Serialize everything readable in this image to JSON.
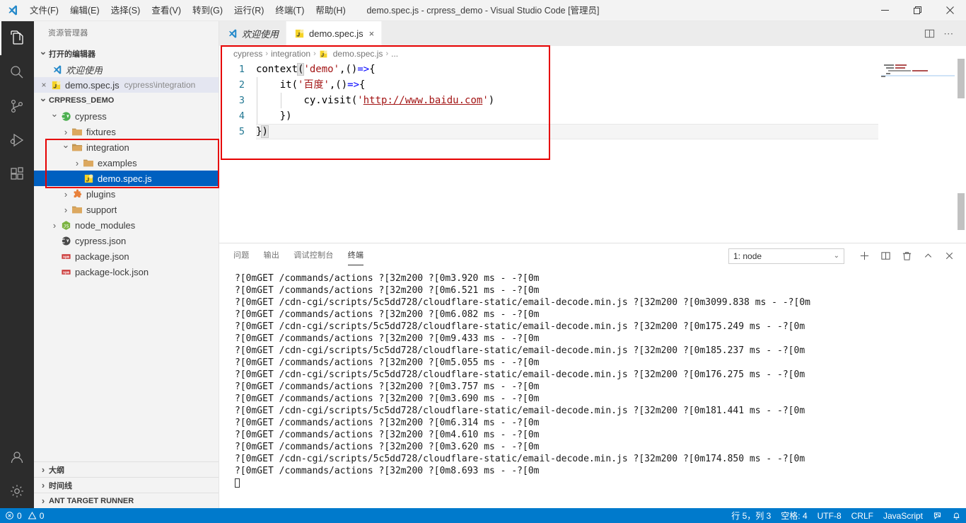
{
  "titlebar": {
    "window_title": "demo.spec.js - crpress_demo - Visual Studio Code [管理员]",
    "logo_icon": "vscode-logo-icon",
    "menus": [
      {
        "label": "文件(F)"
      },
      {
        "label": "编辑(E)"
      },
      {
        "label": "选择(S)"
      },
      {
        "label": "查看(V)"
      },
      {
        "label": "转到(G)"
      },
      {
        "label": "运行(R)"
      },
      {
        "label": "终端(T)"
      },
      {
        "label": "帮助(H)"
      }
    ],
    "controls": [
      {
        "name": "minimize-button",
        "icon": "minimize-icon"
      },
      {
        "name": "maximize-button",
        "icon": "restore-icon"
      },
      {
        "name": "close-button",
        "icon": "close-icon"
      }
    ]
  },
  "activitybar": {
    "items": [
      {
        "name": "explorer",
        "icon": "files-icon",
        "active": true
      },
      {
        "name": "search",
        "icon": "search-icon",
        "active": false
      },
      {
        "name": "source-control",
        "icon": "source-control-icon",
        "active": false
      },
      {
        "name": "run-debug",
        "icon": "run-debug-icon",
        "active": false
      },
      {
        "name": "extensions",
        "icon": "extensions-icon",
        "active": false
      }
    ],
    "bottom": [
      {
        "name": "accounts",
        "icon": "account-icon"
      },
      {
        "name": "manage",
        "icon": "gear-icon"
      }
    ]
  },
  "sidebar": {
    "title": "资源管理器",
    "open_editors": {
      "header": "打开的编辑器",
      "items": [
        {
          "label": "欢迎使用",
          "icon": "vscode-logo-icon",
          "italic": true,
          "sub": "",
          "active": false
        },
        {
          "label": "demo.spec.js",
          "icon": "js-test-icon",
          "italic": false,
          "sub": "cypress\\integration",
          "active": true,
          "close": "×"
        }
      ]
    },
    "project": {
      "header": "CRPRESS_DEMO",
      "tree": [
        {
          "label": "cypress",
          "icon": "cypress-icon",
          "indent": 1,
          "twisty": "down",
          "selected": false
        },
        {
          "label": "fixtures",
          "icon": "folder-icon",
          "indent": 2,
          "twisty": "right",
          "selected": false
        },
        {
          "label": "integration",
          "icon": "folder-open-icon",
          "indent": 2,
          "twisty": "down",
          "selected": false
        },
        {
          "label": "examples",
          "icon": "folder-icon",
          "indent": 3,
          "twisty": "right",
          "selected": false
        },
        {
          "label": "demo.spec.js",
          "icon": "js-test-icon",
          "indent": 4,
          "twisty": "none",
          "selected": true
        },
        {
          "label": "plugins",
          "icon": "plugin-icon",
          "indent": 2,
          "twisty": "right",
          "selected": false
        },
        {
          "label": "support",
          "icon": "folder-icon",
          "indent": 2,
          "twisty": "right",
          "selected": false
        },
        {
          "label": "node_modules",
          "icon": "node-icon",
          "indent": 1,
          "twisty": "right",
          "selected": false
        },
        {
          "label": "cypress.json",
          "icon": "cypress-json-icon",
          "indent": 1,
          "twisty": "none",
          "selected": false
        },
        {
          "label": "package.json",
          "icon": "npm-icon",
          "indent": 1,
          "twisty": "none",
          "selected": false
        },
        {
          "label": "package-lock.json",
          "icon": "npm-icon",
          "indent": 1,
          "twisty": "none",
          "selected": false
        }
      ]
    },
    "bottom_sections": [
      {
        "label": "大纲"
      },
      {
        "label": "时间线"
      },
      {
        "label": "ANT TARGET RUNNER"
      }
    ]
  },
  "editor": {
    "tabs": [
      {
        "label": "欢迎使用",
        "icon": "vscode-logo-icon",
        "active": false,
        "italic": true,
        "closable": false
      },
      {
        "label": "demo.spec.js",
        "icon": "js-test-icon",
        "active": true,
        "italic": false,
        "closable": true,
        "close": "×"
      }
    ],
    "actions": [
      {
        "name": "split-editor-button",
        "icon": "split-editor-icon"
      },
      {
        "name": "more-actions-button",
        "icon": "ellipsis-icon",
        "label": "⋯"
      }
    ],
    "breadcrumb": [
      {
        "label": "cypress",
        "icon": ""
      },
      {
        "label": "integration",
        "icon": ""
      },
      {
        "label": "demo.spec.js",
        "icon": "js-test-icon"
      },
      {
        "label": "...",
        "icon": ""
      }
    ],
    "breadcrumb_separator": "›",
    "code": {
      "language": "javascript",
      "lines": [
        {
          "no": "1",
          "text": "context('demo',()=>{"
        },
        {
          "no": "2",
          "text": "    it('百度',()=>{"
        },
        {
          "no": "3",
          "text": "        cy.visit('http://www.baidu.com')"
        },
        {
          "no": "4",
          "text": "    })"
        },
        {
          "no": "5",
          "text": "})"
        }
      ]
    }
  },
  "panel": {
    "tabs": [
      {
        "label": "问题",
        "active": false
      },
      {
        "label": "输出",
        "active": false
      },
      {
        "label": "调试控制台",
        "active": false
      },
      {
        "label": "终端",
        "active": true
      }
    ],
    "terminal_select": {
      "value": "1: node",
      "chevron": "⌄"
    },
    "actions": [
      {
        "name": "new-terminal-button",
        "icon": "plus-icon"
      },
      {
        "name": "split-terminal-button",
        "icon": "split-icon"
      },
      {
        "name": "kill-terminal-button",
        "icon": "trash-icon"
      },
      {
        "name": "maximize-panel-button",
        "icon": "chevron-up-icon"
      },
      {
        "name": "close-panel-button",
        "icon": "close-icon"
      }
    ],
    "terminal_lines": [
      "?[0mGET /commands/actions ?[32m200 ?[0m3.920 ms - -?[0m",
      "?[0mGET /commands/actions ?[32m200 ?[0m6.521 ms - -?[0m",
      "?[0mGET /cdn-cgi/scripts/5c5dd728/cloudflare-static/email-decode.min.js ?[32m200 ?[0m3099.838 ms - -?[0m",
      "?[0mGET /commands/actions ?[32m200 ?[0m6.082 ms - -?[0m",
      "?[0mGET /cdn-cgi/scripts/5c5dd728/cloudflare-static/email-decode.min.js ?[32m200 ?[0m175.249 ms - -?[0m",
      "?[0mGET /commands/actions ?[32m200 ?[0m9.433 ms - -?[0m",
      "?[0mGET /cdn-cgi/scripts/5c5dd728/cloudflare-static/email-decode.min.js ?[32m200 ?[0m185.237 ms - -?[0m",
      "?[0mGET /commands/actions ?[32m200 ?[0m5.055 ms - -?[0m",
      "?[0mGET /cdn-cgi/scripts/5c5dd728/cloudflare-static/email-decode.min.js ?[32m200 ?[0m176.275 ms - -?[0m",
      "?[0mGET /commands/actions ?[32m200 ?[0m3.757 ms - -?[0m",
      "?[0mGET /commands/actions ?[32m200 ?[0m3.690 ms - -?[0m",
      "?[0mGET /cdn-cgi/scripts/5c5dd728/cloudflare-static/email-decode.min.js ?[32m200 ?[0m181.441 ms - -?[0m",
      "?[0mGET /commands/actions ?[32m200 ?[0m6.314 ms - -?[0m",
      "?[0mGET /commands/actions ?[32m200 ?[0m4.610 ms - -?[0m",
      "?[0mGET /commands/actions ?[32m200 ?[0m3.620 ms - -?[0m",
      "?[0mGET /cdn-cgi/scripts/5c5dd728/cloudflare-static/email-decode.min.js ?[32m200 ?[0m174.850 ms - -?[0m",
      "?[0mGET /commands/actions ?[32m200 ?[0m8.693 ms - -?[0m"
    ]
  },
  "statusbar": {
    "errors": "0",
    "warnings": "0",
    "cursor_position": "行 5，列 3",
    "indent": "空格: 4",
    "encoding": "UTF-8",
    "eol": "CRLF",
    "language": "JavaScript",
    "feedback_icon": "feedback-icon",
    "bell_icon": "bell-icon"
  },
  "colors": {
    "accent": "#007acc",
    "selection": "#0060c0",
    "annotation": "#e60000",
    "titlebar_bg": "#f3f3f3",
    "activitybar_bg": "#2c2c2c",
    "sidebar_bg": "#f3f3f3"
  }
}
